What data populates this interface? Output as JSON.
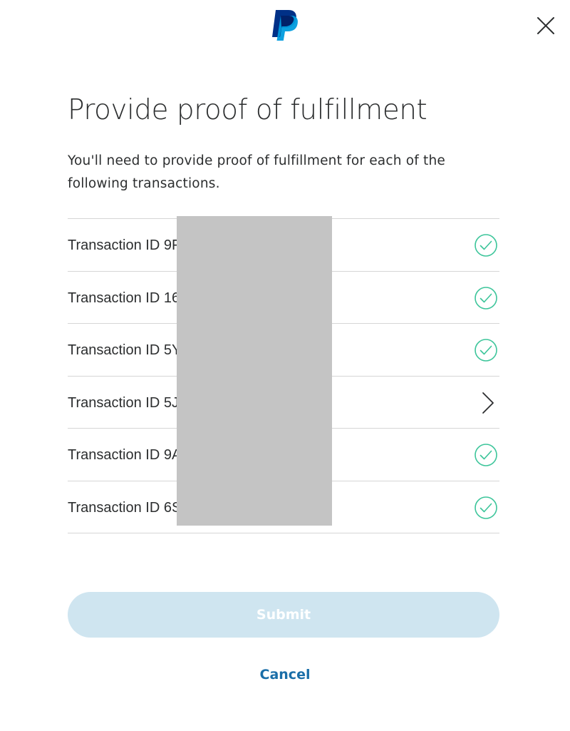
{
  "header": {
    "logo_icon": "paypal-logo",
    "close_icon": "close-x-icon"
  },
  "main": {
    "title": "Provide proof of fulfillment",
    "intro": "You'll need to provide proof of fulfillment for each of the following transactions."
  },
  "transactions": [
    {
      "label": "Transaction ID 9F",
      "status": "complete"
    },
    {
      "label": "Transaction ID 16",
      "status": "complete"
    },
    {
      "label": "Transaction ID 5Y",
      "status": "complete"
    },
    {
      "label": "Transaction ID 5J",
      "status": "pending"
    },
    {
      "label": "Transaction ID 9A",
      "status": "complete"
    },
    {
      "label": "Transaction ID 6S",
      "status": "complete"
    }
  ],
  "actions": {
    "submit_label": "Submit",
    "submit_enabled": false,
    "cancel_label": "Cancel"
  },
  "colors": {
    "check": "#3cc59a",
    "link": "#1a6ea8",
    "submit_disabled_bg": "#cfe5f0",
    "divider": "#d6d6d6",
    "paypal_dark": "#003087",
    "paypal_light": "#009cde",
    "redaction": "#c4c4c4"
  }
}
